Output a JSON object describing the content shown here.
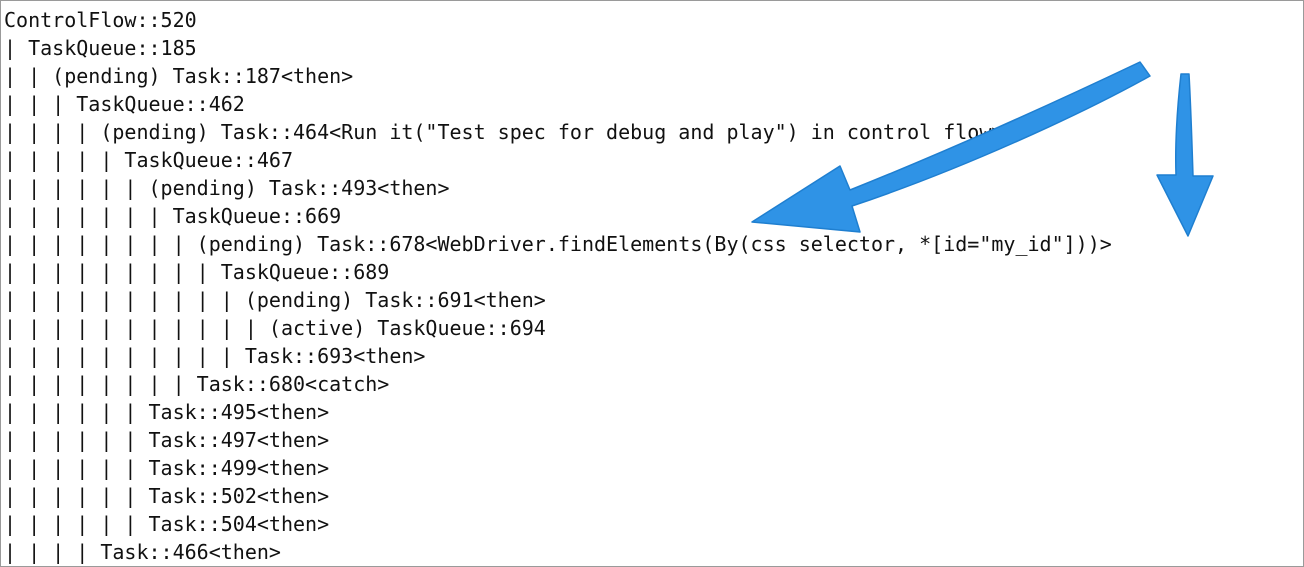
{
  "console": {
    "lines": [
      "ControlFlow::520",
      "| TaskQueue::185",
      "| | (pending) Task::187<then>",
      "| | | TaskQueue::462",
      "| | | | (pending) Task::464<Run it(\"Test spec for debug and play\") in control flow>",
      "| | | | | TaskQueue::467",
      "| | | | | | (pending) Task::493<then>",
      "| | | | | | | TaskQueue::669",
      "| | | | | | | | (pending) Task::678<WebDriver.findElements(By(css selector, *[id=\"my_id\"]))>",
      "| | | | | | | | | TaskQueue::689",
      "| | | | | | | | | | (pending) Task::691<then>",
      "| | | | | | | | | | | (active) TaskQueue::694",
      "| | | | | | | | | | Task::693<then>",
      "| | | | | | | | Task::680<catch>",
      "| | | | | | Task::495<then>",
      "| | | | | | Task::497<then>",
      "| | | | | | Task::499<then>",
      "| | | | | | Task::502<then>",
      "| | | | | | Task::504<then>",
      "| | | | Task::466<then>"
    ]
  },
  "annotations": {
    "arrow_color": "#2f93e6",
    "arrows": [
      {
        "name": "arrow-to-findelements-icon",
        "points_to": "WebDriver.findElements"
      },
      {
        "name": "arrow-to-my-id-icon",
        "points_to": "my_id"
      }
    ]
  }
}
